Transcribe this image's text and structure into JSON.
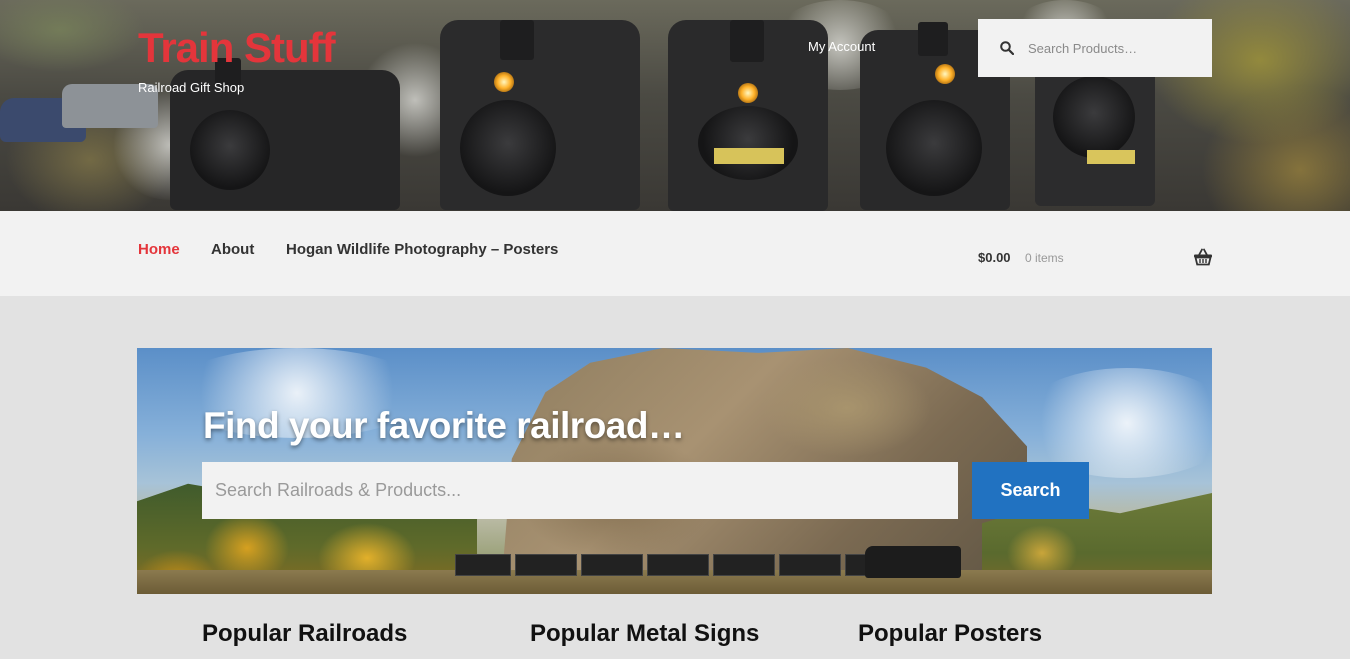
{
  "header": {
    "title": "Train Stuff",
    "tagline": "Railroad Gift Shop",
    "my_account": "My Account",
    "search_placeholder": "Search Products…",
    "search_icon": "search-icon"
  },
  "nav": {
    "items": [
      {
        "label": "Home",
        "active": true
      },
      {
        "label": "About",
        "active": false
      },
      {
        "label": "Hogan Wildlife Photography – Posters",
        "active": false
      }
    ],
    "cart": {
      "amount": "$0.00",
      "count": "0 items",
      "icon": "basket-icon"
    }
  },
  "hero": {
    "title": "Find your favorite railroad…",
    "search_placeholder": "Search Railroads & Products...",
    "button_label": "Search"
  },
  "sections": [
    {
      "heading": "Popular Railroads"
    },
    {
      "heading": "Popular Metal Signs"
    },
    {
      "heading": "Popular Posters"
    }
  ],
  "colors": {
    "brand_red": "#e4353b",
    "button_blue": "#2172c1",
    "nav_bg": "#f2f2f2",
    "page_bg": "#e2e2e2"
  }
}
